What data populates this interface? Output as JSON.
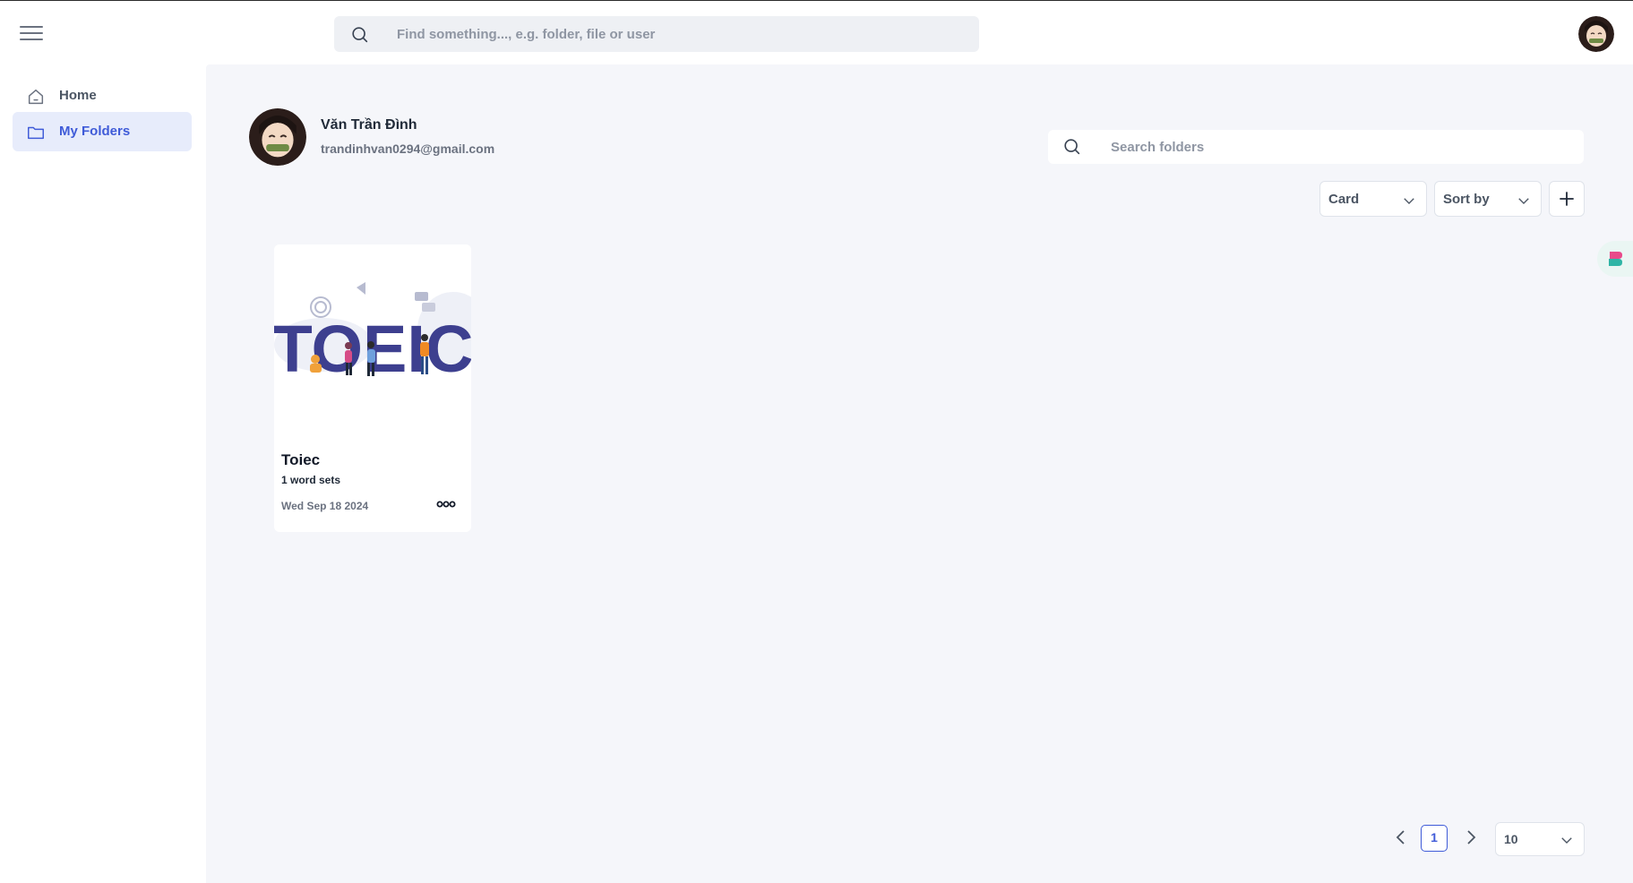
{
  "header": {
    "search_placeholder": "Find something..., e.g. folder, file or user"
  },
  "sidebar": {
    "items": [
      {
        "label": "Home",
        "icon": "home-icon",
        "active": false
      },
      {
        "label": "My Folders",
        "icon": "folder-icon",
        "active": true
      }
    ]
  },
  "profile": {
    "name": "Văn Trần Đình",
    "email": "trandinhvan0294@gmail.com"
  },
  "folders_toolbar": {
    "search_placeholder": "Search folders",
    "view_select": "Card",
    "sort_select": "Sort by",
    "add_icon": "plus-icon"
  },
  "folders": [
    {
      "title": "Toiec",
      "image_text": "TOEIC",
      "subtitle": "1 word sets",
      "date": "Wed Sep 18 2024",
      "more_icon": "more-horizontal-icon"
    }
  ],
  "pagination": {
    "current_page": "1",
    "page_size": "10"
  },
  "colors": {
    "accent": "#3f5bd8",
    "main_bg": "#f5f6fa",
    "active_nav_bg": "#e7ecfb",
    "toeic_text": "#3d3f8f"
  }
}
